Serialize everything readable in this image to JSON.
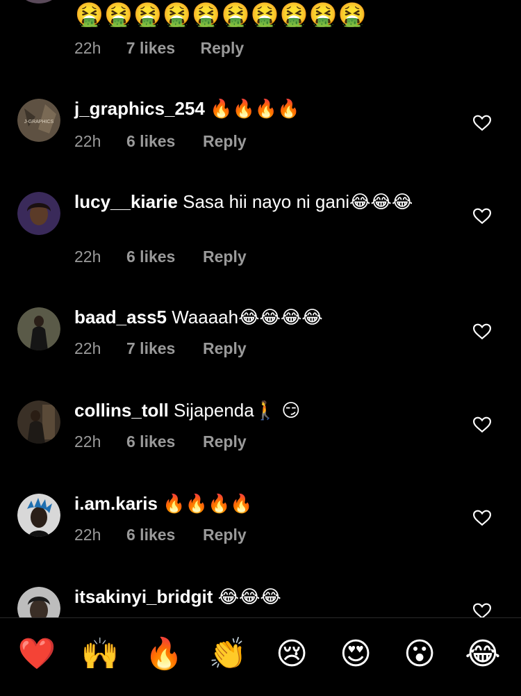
{
  "top_comment": {
    "emojis": "🤮🤮🤮🤮🤮🤮🤮🤮🤮🤮",
    "time": "22h",
    "likes": "7 likes",
    "reply": "Reply"
  },
  "comments": [
    {
      "username": "j_graphics_254",
      "text": " 🔥🔥🔥🔥",
      "time": "22h",
      "likes": "6 likes",
      "reply": "Reply",
      "avatar_color": "#6b5b4a",
      "avatar_label": "J-GRAPHICS"
    },
    {
      "username": "lucy__kiarie",
      "text": " Sasa hii nayo ni gani😂😂😂",
      "time": "22h",
      "likes": "6 likes",
      "reply": "Reply",
      "avatar_color": "#3a2a5a"
    },
    {
      "username": "baad_ass5",
      "text": " Waaaah😂😂😂😂",
      "time": "22h",
      "likes": "7 likes",
      "reply": "Reply",
      "avatar_color": "#4a4a3a"
    },
    {
      "username": "collins_toll",
      "text": " Sijapenda🚶 😏",
      "time": "22h",
      "likes": "6 likes",
      "reply": "Reply",
      "avatar_color": "#3a3026"
    },
    {
      "username": "i.am.karis",
      "text": " 🔥🔥🔥🔥",
      "time": "22h",
      "likes": "6 likes",
      "reply": "Reply",
      "avatar_color": "#d8d8d8"
    },
    {
      "username": "itsakinyi_bridgit",
      "text": " 😂😂😂",
      "time": "",
      "likes": "",
      "reply": "",
      "avatar_color": "#9a9a9a"
    }
  ],
  "reaction_bar": [
    "❤️",
    "🙌",
    "🔥",
    "👏",
    "😢",
    "😍",
    "😮",
    "😂"
  ],
  "colors": {
    "background": "#000000",
    "text": "#ffffff",
    "meta": "#9a9a9a",
    "heart_outline": "#ffffff"
  }
}
